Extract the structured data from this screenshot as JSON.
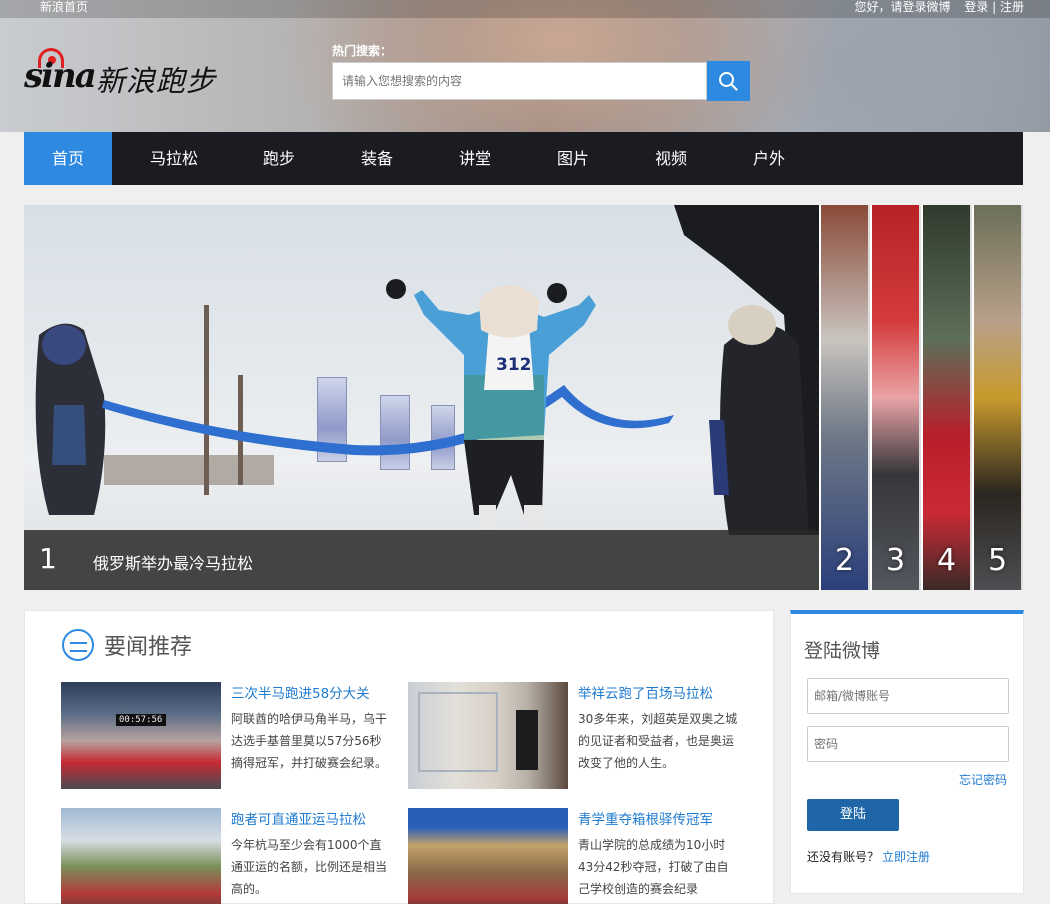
{
  "topbar": {
    "home_link": "新浪首页",
    "greeting": "您好，请登录微博",
    "login_register": "登录 | 注册"
  },
  "logo": {
    "brand": "sina",
    "site_name": "新浪跑步"
  },
  "search": {
    "hot_label": "热门搜索：",
    "placeholder": "请输入您想搜索的内容"
  },
  "nav": {
    "items": [
      {
        "label": "首页",
        "active": true
      },
      {
        "label": "马拉松"
      },
      {
        "label": "跑步"
      },
      {
        "label": "装备"
      },
      {
        "label": "讲堂"
      },
      {
        "label": "图片"
      },
      {
        "label": "视频"
      },
      {
        "label": "户外"
      }
    ]
  },
  "slider": {
    "active_index": "1",
    "caption": "俄罗斯举办最冷马拉松",
    "bib_number": "312",
    "thumbnails": [
      "2",
      "3",
      "4",
      "5"
    ]
  },
  "news": {
    "section_title": "要闻推荐",
    "items": [
      {
        "title": "三次半马跑进58分大关",
        "desc": "阿联酋的哈伊马角半马，乌干达选手基普里莫以57分56秒摘得冠军，并打破赛会纪录。",
        "timer_text": "00:57:56"
      },
      {
        "title": "举祥云跑了百场马拉松",
        "desc": "30多年来，刘超英是双奥之城的见证者和受益者，也是奥运改变了他的人生。"
      },
      {
        "title": "跑者可直通亚运马拉松",
        "desc": "今年杭马至少会有1000个直通亚运的名额，比例还是相当高的。"
      },
      {
        "title": "青学重夺箱根驿传冠军",
        "desc": "青山学院的总成绩为10小时43分42秒夺冠，打破了由自己学校创造的赛会纪录"
      }
    ]
  },
  "login": {
    "title": "登陆微博",
    "account_placeholder": "邮箱/微博账号",
    "password_placeholder": "密码",
    "forgot": "忘记密码",
    "submit": "登陆",
    "no_account": "还没有账号？",
    "register_link": "立即注册"
  },
  "colors": {
    "accent": "#2d8ae0",
    "nav_bg": "#1a1c22",
    "link": "#1f7bd0",
    "button": "#1f66a8"
  }
}
